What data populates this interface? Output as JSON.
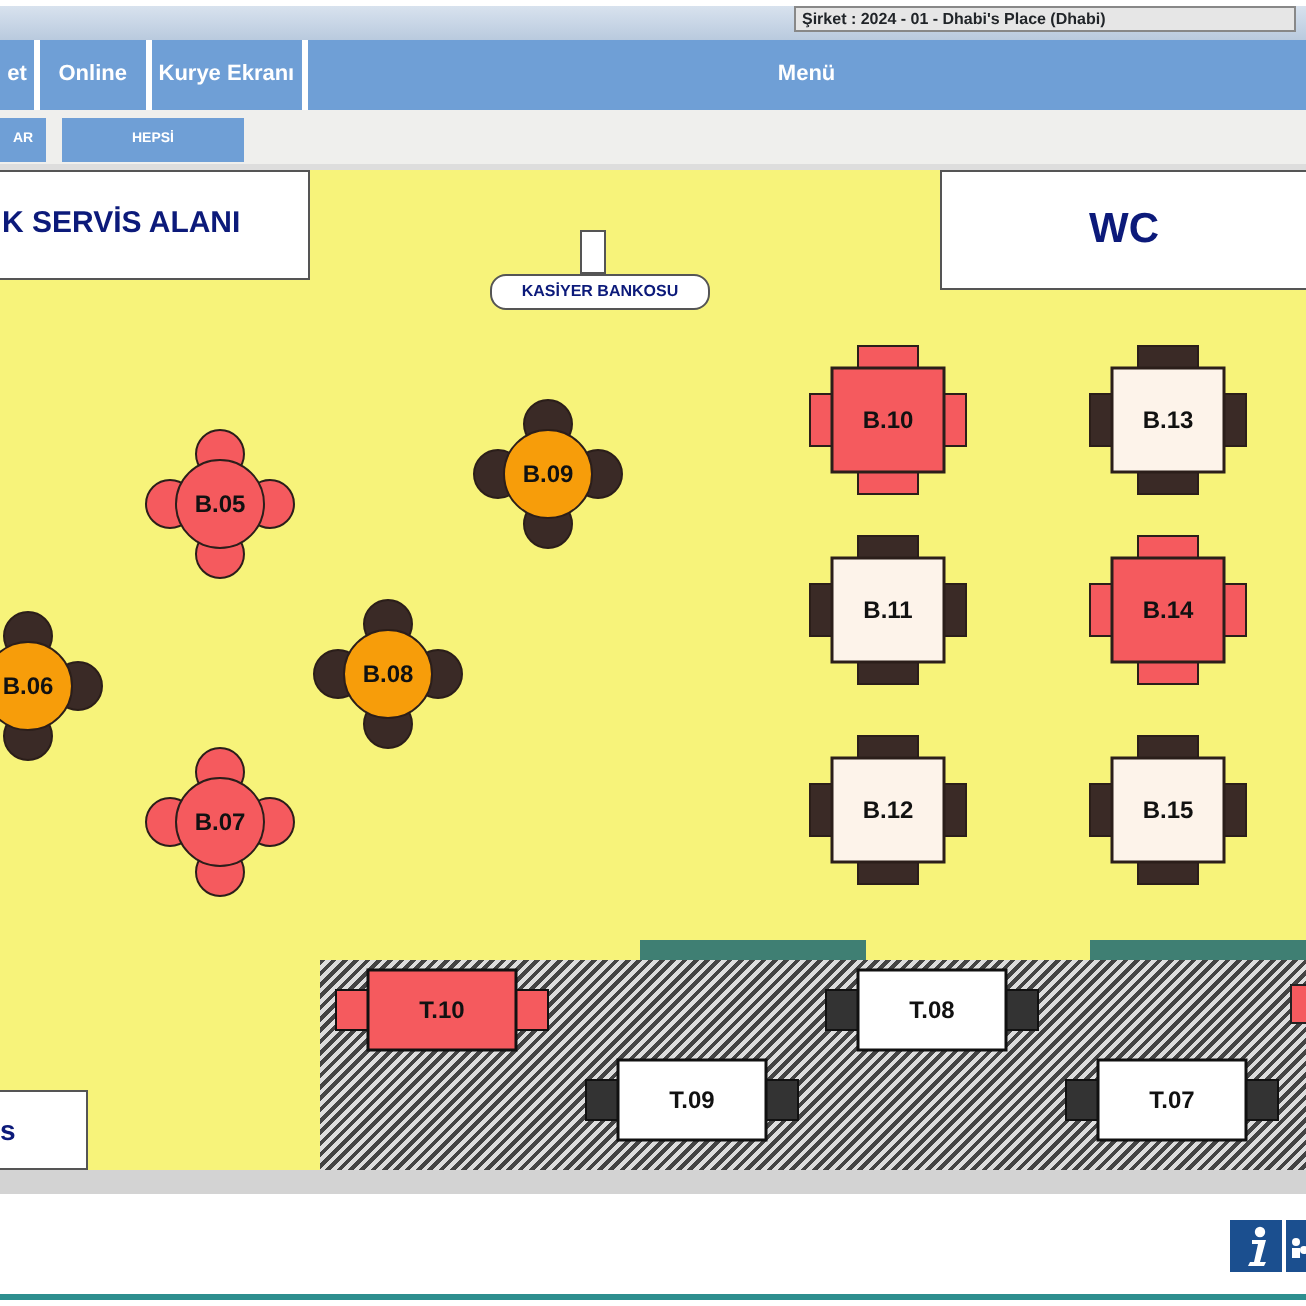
{
  "company": "Şirket : 2024 - 01 - Dhabi's Place (Dhabi)",
  "nav_tabs": [
    {
      "label": "et"
    },
    {
      "label": "Online"
    },
    {
      "label": "Kurye Ekranı"
    },
    {
      "label": "Menü"
    }
  ],
  "filter_buttons": [
    {
      "label": "AR"
    },
    {
      "label": "HEPSİ"
    }
  ],
  "floor": {
    "areas": [
      {
        "kind": "service",
        "label": "K SERVİS ALANI"
      },
      {
        "kind": "wc",
        "label": "WC"
      },
      {
        "kind": "cashier",
        "label": "KASİYER BANKOSU"
      },
      {
        "kind": "corner",
        "label": "s"
      }
    ],
    "tables": [
      {
        "label": "B.05",
        "kind": "round",
        "occupied": true,
        "color": "#f55a5e"
      },
      {
        "label": "B.09",
        "kind": "round",
        "occupied": false,
        "color": "#f79d0a"
      },
      {
        "label": "B.06",
        "kind": "round",
        "occupied": false,
        "color": "#f79d0a"
      },
      {
        "label": "B.08",
        "kind": "round",
        "occupied": false,
        "color": "#f79d0a"
      },
      {
        "label": "B.07",
        "kind": "round",
        "occupied": true,
        "color": "#f55a5e"
      },
      {
        "label": "B.10",
        "kind": "square",
        "occupied": true,
        "color": "#f55a5e"
      },
      {
        "label": "B.13",
        "kind": "square",
        "occupied": false,
        "color": "#fdf3ea"
      },
      {
        "label": "B.11",
        "kind": "square",
        "occupied": false,
        "color": "#fdf3ea"
      },
      {
        "label": "B.14",
        "kind": "square",
        "occupied": true,
        "color": "#f55a5e"
      },
      {
        "label": "B.12",
        "kind": "square",
        "occupied": false,
        "color": "#fdf3ea"
      },
      {
        "label": "B.15",
        "kind": "square",
        "occupied": false,
        "color": "#fdf3ea"
      },
      {
        "label": "T.10",
        "kind": "long",
        "occupied": true,
        "color": "#f55a5e"
      },
      {
        "label": "T.08",
        "kind": "long",
        "occupied": false,
        "color": "#ffffff"
      },
      {
        "label": "T.09",
        "kind": "long",
        "occupied": false,
        "color": "#ffffff"
      },
      {
        "label": "T.07",
        "kind": "long",
        "occupied": false,
        "color": "#ffffff"
      }
    ]
  }
}
